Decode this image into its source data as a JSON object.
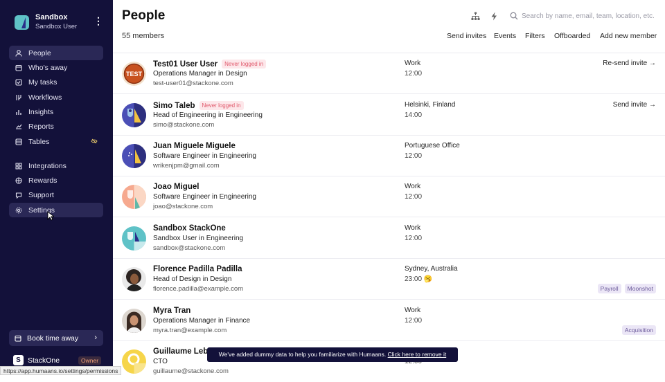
{
  "workspace": {
    "name": "Sandbox",
    "subtitle": "Sandbox User"
  },
  "sidebar": {
    "nav": [
      {
        "label": "People",
        "icon": "person-icon"
      },
      {
        "label": "Who's away",
        "icon": "calendar-icon"
      },
      {
        "label": "My tasks",
        "icon": "checkbox-icon"
      },
      {
        "label": "Workflows",
        "icon": "workflow-icon"
      },
      {
        "label": "Insights",
        "icon": "bar-chart-icon"
      },
      {
        "label": "Reports",
        "icon": "report-icon"
      },
      {
        "label": "Tables",
        "icon": "table-icon"
      }
    ],
    "nav2": [
      {
        "label": "Integrations",
        "icon": "integrations-icon"
      },
      {
        "label": "Rewards",
        "icon": "gift-icon"
      },
      {
        "label": "Support",
        "icon": "chat-icon"
      },
      {
        "label": "Settings",
        "icon": "gear-icon"
      }
    ],
    "book_label": "Book time away",
    "org_name": "StackOne",
    "org_initial": "S",
    "org_role": "Owner"
  },
  "status_url": "https://app.humaans.io/settings/permissions",
  "header": {
    "title": "People",
    "member_count": "55 members",
    "search_placeholder": "Search by name, email, team, location, etc.",
    "actions": [
      "Send invites",
      "Events",
      "Filters",
      "Offboarded",
      "Add new member"
    ]
  },
  "people": [
    {
      "name": "Test01 User User",
      "badge": "Never logged in",
      "role": "Operations Manager in Design",
      "email": "test-user01@stackone.com",
      "location": "Work",
      "time": "12:00",
      "action": "Re-send invite →",
      "tags": [],
      "avatar": "test"
    },
    {
      "name": "Simo Taleb",
      "badge": "Never logged in",
      "role": "Head of Engineering in Engineering",
      "email": "simo@stackone.com",
      "location": "Helsinki, Finland",
      "time": "14:00",
      "action": "Send invite →",
      "tags": [],
      "avatar": "blue"
    },
    {
      "name": "Juan Miguele Miguele",
      "badge": "",
      "role": "Software Engineer in Engineering",
      "email": "wrikenjpm@gmail.com",
      "location": "Portuguese Office",
      "time": "12:00",
      "action": "",
      "tags": [],
      "avatar": "blue2"
    },
    {
      "name": "Joao Miguel",
      "badge": "",
      "role": "Software Engineer in Engineering",
      "email": "joao@stackone.com",
      "location": "Work",
      "time": "12:00",
      "action": "",
      "tags": [],
      "avatar": "peach"
    },
    {
      "name": "Sandbox StackOne",
      "badge": "",
      "role": "Sandbox User in Engineering",
      "email": "sandbox@stackone.com",
      "location": "Work",
      "time": "12:00",
      "action": "",
      "tags": [],
      "avatar": "teal"
    },
    {
      "name": "Florence Padilla Padilla",
      "badge": "",
      "role": "Head of Design in Design",
      "email": "florence.padilla@example.com",
      "location": "Sydney, Australia",
      "time": "23:00 🥱",
      "action": "",
      "tags": [
        "Payroll",
        "Moonshot"
      ],
      "avatar": "photo1"
    },
    {
      "name": "Myra Tran",
      "badge": "",
      "role": "Operations Manager in Finance",
      "email": "myra.tran@example.com",
      "location": "Work",
      "time": "12:00",
      "action": "",
      "tags": [
        "Acquisition"
      ],
      "avatar": "photo2"
    },
    {
      "name": "Guillaume Lebe",
      "badge": "",
      "role": "CTO",
      "email": "guillaume@stackone.com",
      "location": "",
      "time": "12:00",
      "action": "",
      "tags": [],
      "avatar": "yellow"
    }
  ],
  "toast": {
    "text": "We've added dummy data to help you familiarize with Humaans.",
    "link": "Click here to remove it"
  }
}
